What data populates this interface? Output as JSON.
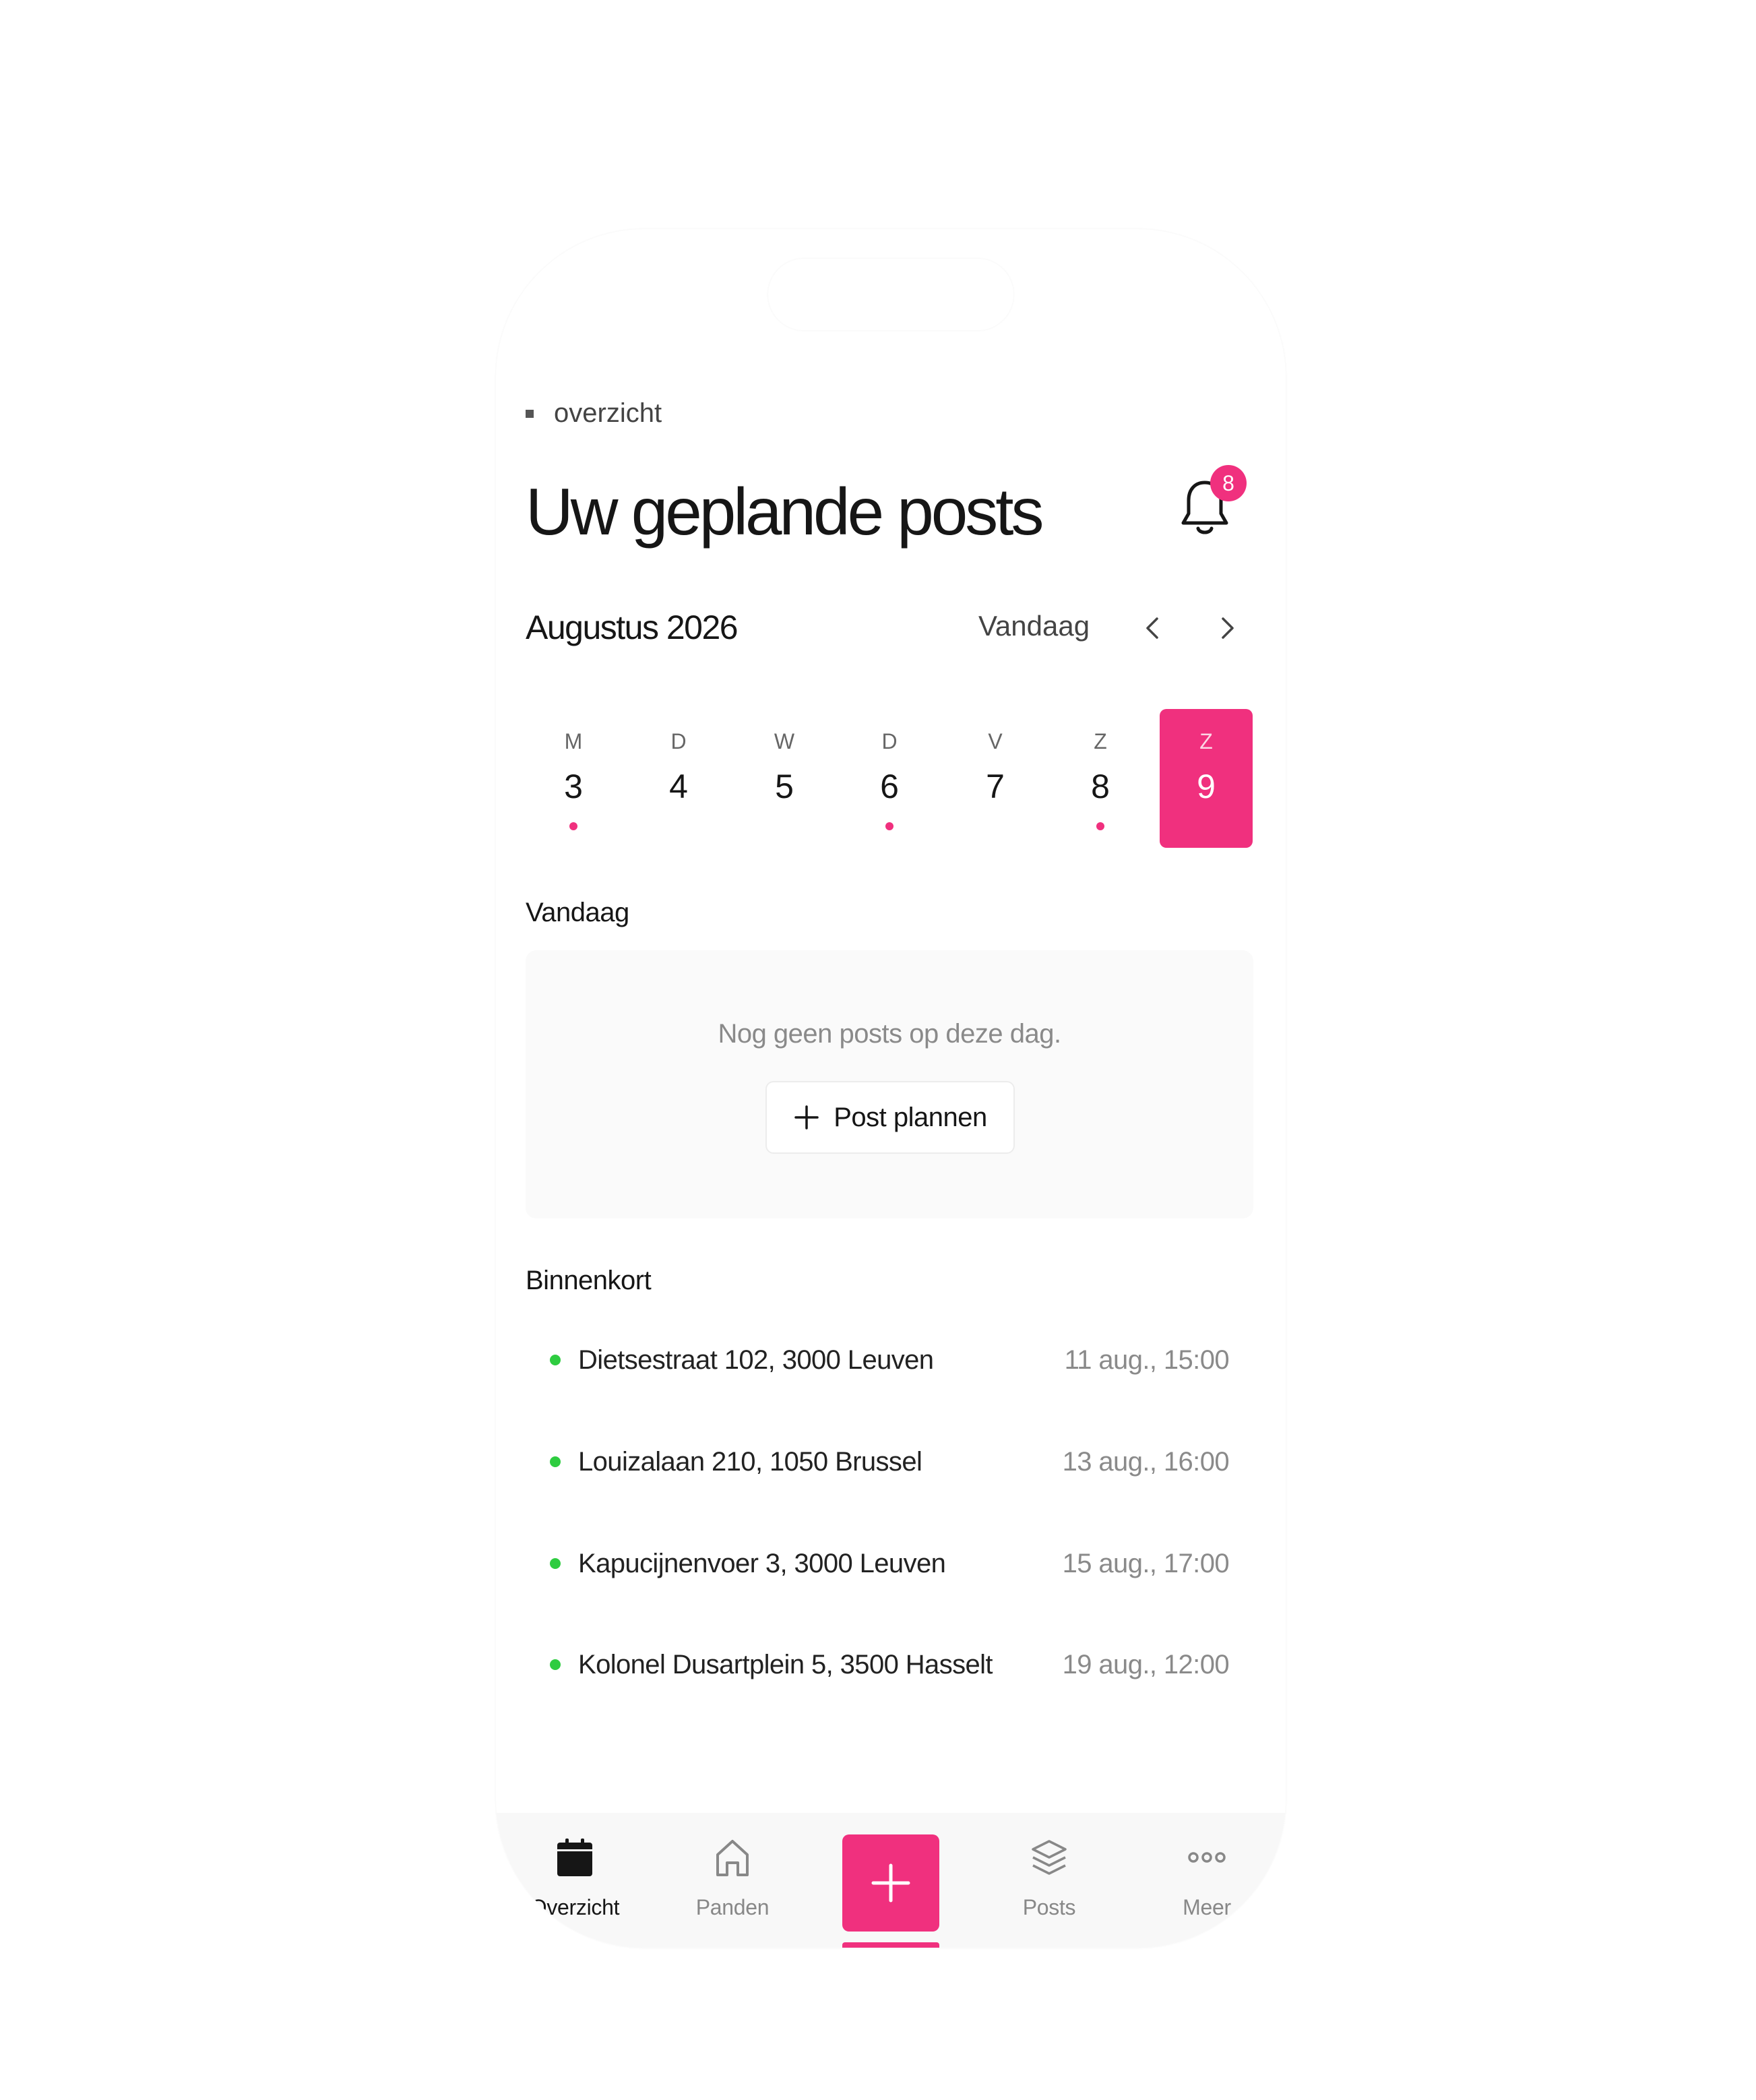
{
  "breadcrumb": {
    "label": "overzicht"
  },
  "header": {
    "title": "Uw geplande posts",
    "notification_count": "8"
  },
  "calendar": {
    "month_label": "Augustus 2026",
    "today_label": "Vandaag",
    "days": [
      {
        "weekday": "M",
        "date": "3",
        "has_posts": true,
        "selected": false
      },
      {
        "weekday": "D",
        "date": "4",
        "has_posts": false,
        "selected": false
      },
      {
        "weekday": "W",
        "date": "5",
        "has_posts": false,
        "selected": false
      },
      {
        "weekday": "D",
        "date": "6",
        "has_posts": true,
        "selected": false
      },
      {
        "weekday": "V",
        "date": "7",
        "has_posts": false,
        "selected": false
      },
      {
        "weekday": "Z",
        "date": "8",
        "has_posts": true,
        "selected": false
      },
      {
        "weekday": "Z",
        "date": "9",
        "has_posts": false,
        "selected": true
      }
    ]
  },
  "today_section": {
    "label": "Vandaag",
    "empty_text": "Nog geen posts op deze dag.",
    "plan_button_label": "Post plannen"
  },
  "upcoming_section": {
    "label": "Binnenkort",
    "items": [
      {
        "address": "Dietsestraat 102, 3000 Leuven",
        "when": "11 aug., 15:00"
      },
      {
        "address": "Louizalaan 210, 1050 Brussel",
        "when": "13 aug., 16:00"
      },
      {
        "address": "Kapucijnenvoer 3, 3000 Leuven",
        "when": "15 aug., 17:00"
      },
      {
        "address": "Kolonel Dusartplein 5, 3500 Hasselt",
        "when": "19 aug., 12:00"
      }
    ]
  },
  "tabbar": {
    "tabs": [
      {
        "label": "Overzicht",
        "icon": "calendar-icon",
        "active": true
      },
      {
        "label": "Panden",
        "icon": "home-icon",
        "active": false
      },
      {
        "label": "Posts",
        "icon": "layers-icon",
        "active": false
      },
      {
        "label": "Meer",
        "icon": "more-icon",
        "active": false
      }
    ],
    "fab_icon": "plus-icon"
  },
  "colors": {
    "accent": "#f0307e",
    "status_green": "#2ecc40",
    "text_dark": "#161616",
    "text_muted": "#8a8a8a"
  }
}
